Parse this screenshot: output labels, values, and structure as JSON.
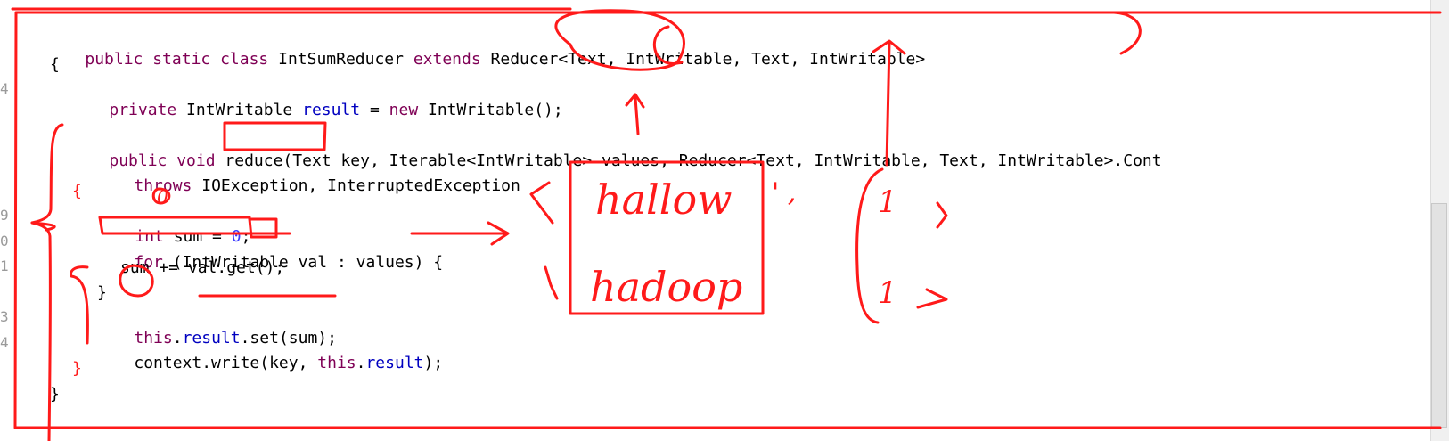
{
  "gutter": {
    "numbers": [
      "4",
      "9",
      "0",
      "1",
      "3",
      "4"
    ]
  },
  "code": {
    "l1": {
      "kw1": "public static class",
      "name": " IntSumReducer ",
      "kw2": "extends",
      "rest": " Reducer<Text, IntWritable, Text, IntWritable>"
    },
    "l2": {
      "text": "{"
    },
    "l3": {
      "kw": "private",
      "type": " IntWritable ",
      "field": "result",
      "eq": " = ",
      "kw2": "new",
      "rest": " IntWritable();"
    },
    "l4": {
      "kw": "public void",
      "rest": " reduce(Text key, Iterable<IntWritable> values, Reducer<Text, IntWritable, Text, IntWritable>.Cont"
    },
    "l5": {
      "kw": "throws",
      "rest": " IOException, InterruptedException"
    },
    "l6": {
      "text": "{"
    },
    "l7": {
      "kw": "int",
      "mid": " sum = ",
      "num": "0",
      "end": ";"
    },
    "l8": {
      "kw": "for",
      "rest": " (IntWritable val : values) {"
    },
    "l9": {
      "text": "sum += val.get();"
    },
    "l10": {
      "text": "}"
    },
    "l11": {
      "kw": "this",
      "dot": ".",
      "field": "result",
      "rest": ".set(sum);"
    },
    "l12": {
      "pre": "context.write(key, ",
      "kw": "this",
      "dot": ".",
      "field": "result",
      "rest": ");"
    },
    "l13": {
      "text": "}"
    },
    "l14": {
      "text": "}"
    }
  },
  "annotations": {
    "zero_note": "0",
    "word1": "hallow",
    "word2": "hadoop",
    "one": "1",
    "sep": "' ,"
  },
  "colors": {
    "keyword": "#7f0055",
    "field": "#0000c0",
    "number": "#3b3bff",
    "ink": "#ff1a1a"
  }
}
